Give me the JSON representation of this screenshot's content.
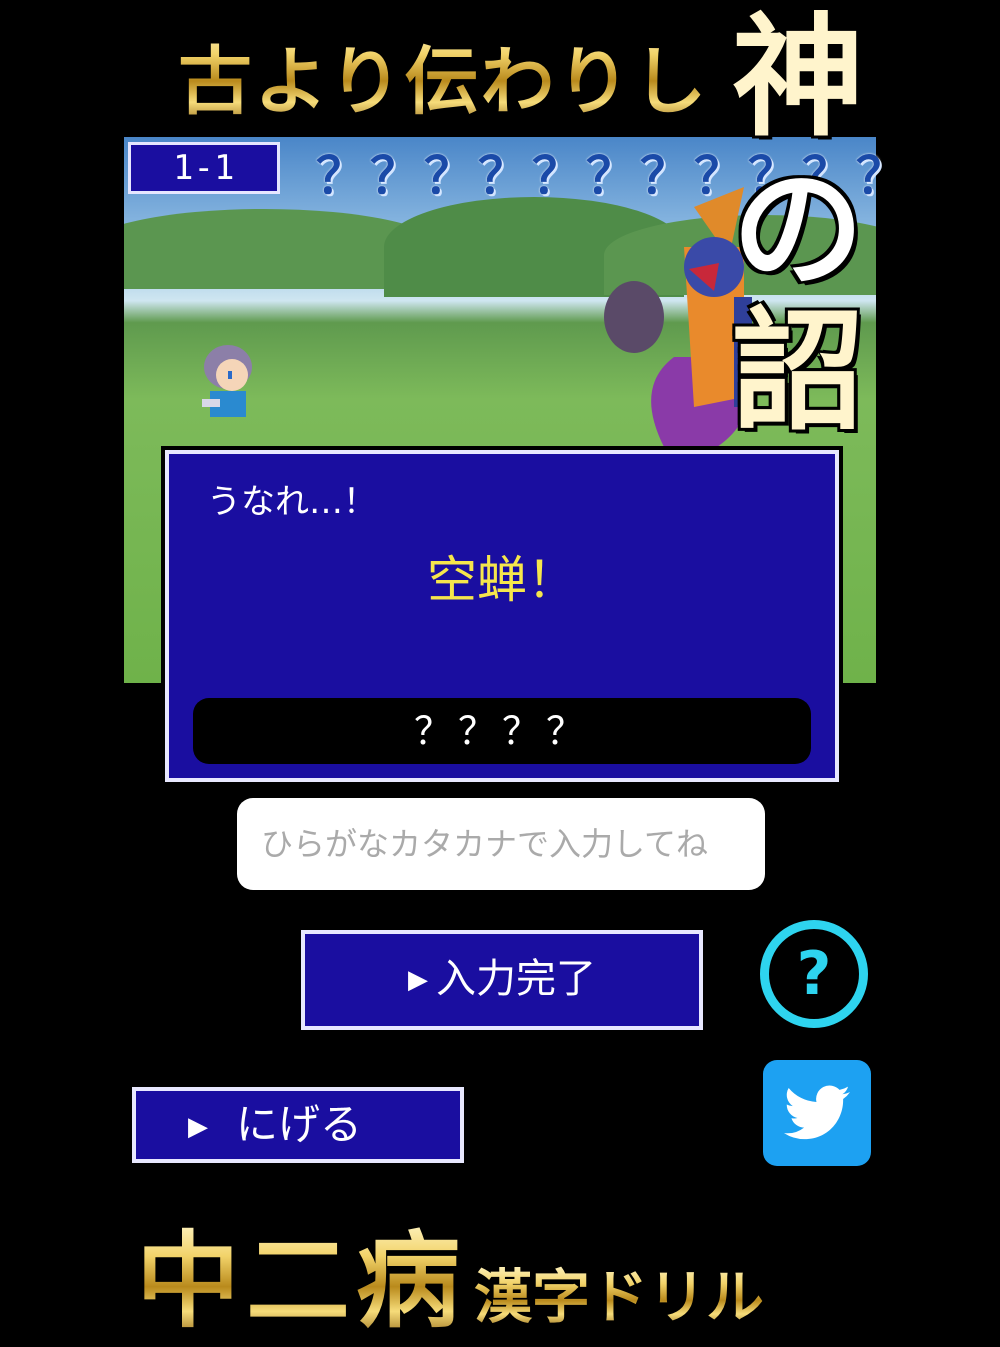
{
  "promo": {
    "headline": "古より伝わりし",
    "big_kanji": [
      "神",
      "の",
      "詔"
    ],
    "brand_main": "中二病",
    "brand_sub": "漢字ドリル"
  },
  "battle": {
    "stage": "1-1",
    "answer_hint": "？？？？？？？？？？？"
  },
  "message": {
    "speaker_line": "うなれ…！",
    "spell": "空蝉！",
    "answer_mask": "？？？？"
  },
  "input": {
    "placeholder": "ひらがなカタカナで入力してね",
    "value": ""
  },
  "buttons": {
    "submit": "入力完了",
    "run": "にげる",
    "help": "?",
    "arrow": "▶"
  },
  "icons": {
    "help": "question-circle-icon",
    "share": "twitter-bird-icon"
  },
  "colors": {
    "window_bg": "#1a0ea0",
    "spell_yellow": "#f6e64c",
    "help_cyan": "#2ed4ef",
    "twitter_blue": "#1da1f2"
  }
}
